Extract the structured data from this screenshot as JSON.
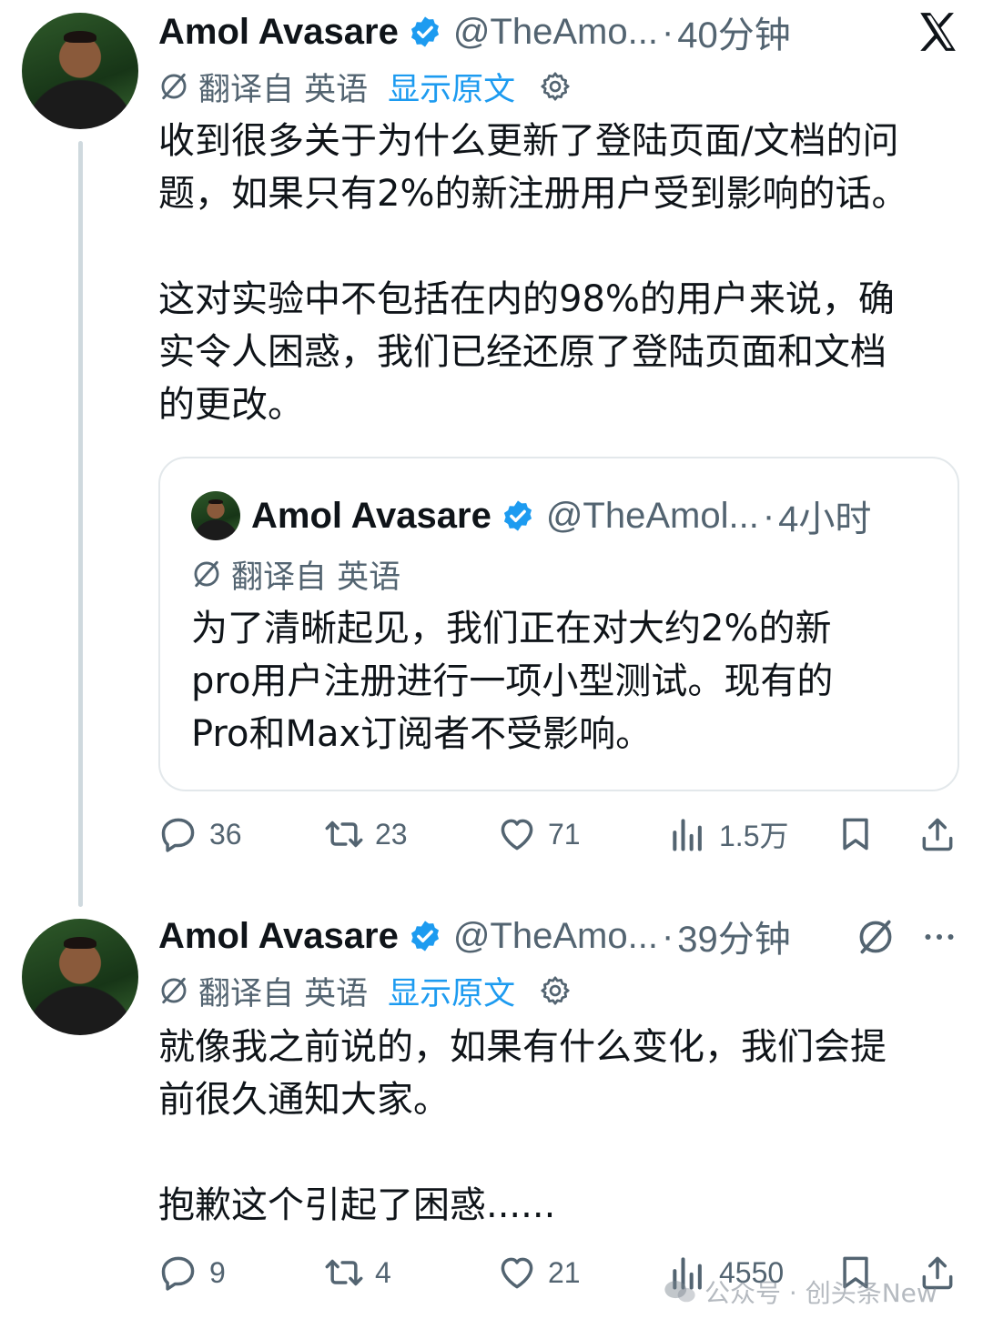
{
  "colors": {
    "text": "#0f1419",
    "secondary": "#536471",
    "link": "#1d9bf0",
    "verified": "#1d9bf0",
    "thread_line": "#cfd9de",
    "card_border": "#e3e8eb"
  },
  "tweet1": {
    "name": "Amol Avasare",
    "handle": "@TheAmo...",
    "dot": "·",
    "time": "40分钟",
    "translated_from": "翻译自 英语",
    "show_original": "显示原文",
    "text": "收到很多关于为什么更新了登陆页面/文档的问\n题，如果只有2%的新注册用户受到影响的话。\n\n这对实验中不包括在内的98%的用户来说，确\n实令人困惑，我们已经还原了登陆页面和文档\n的更改。",
    "quote": {
      "name": "Amol Avasare",
      "handle": "@TheAmol...",
      "dot": "·",
      "time": "4小时",
      "translated_from": "翻译自 英语",
      "text": "为了清晰起见，我们正在对大约2%的新\npro用户注册进行一项小型测试。现有的\nPro和Max订阅者不受影响。"
    },
    "stats": {
      "replies": "36",
      "reposts": "23",
      "likes": "71",
      "views": "1.5万"
    }
  },
  "tweet2": {
    "name": "Amol Avasare",
    "handle": "@TheAmo...",
    "dot": "·",
    "time": "39分钟",
    "translated_from": "翻译自 英语",
    "show_original": "显示原文",
    "text": "就像我之前说的，如果有什么变化，我们会提\n前很久通知大家。\n\n抱歉这个引起了困惑......",
    "stats": {
      "replies": "9",
      "reposts": "4",
      "likes": "21",
      "views": "4550"
    }
  },
  "icons": {
    "close": "x-logo-icon",
    "verified": "verified-badge-icon",
    "translate": "translate-icon",
    "settings": "gear-icon",
    "reply": "reply-icon",
    "repost": "repost-icon",
    "like": "heart-icon",
    "views": "views-icon",
    "bookmark": "bookmark-icon",
    "share": "share-icon",
    "more": "more-icon"
  },
  "watermark": {
    "text": "公众号 · 创头条New"
  }
}
